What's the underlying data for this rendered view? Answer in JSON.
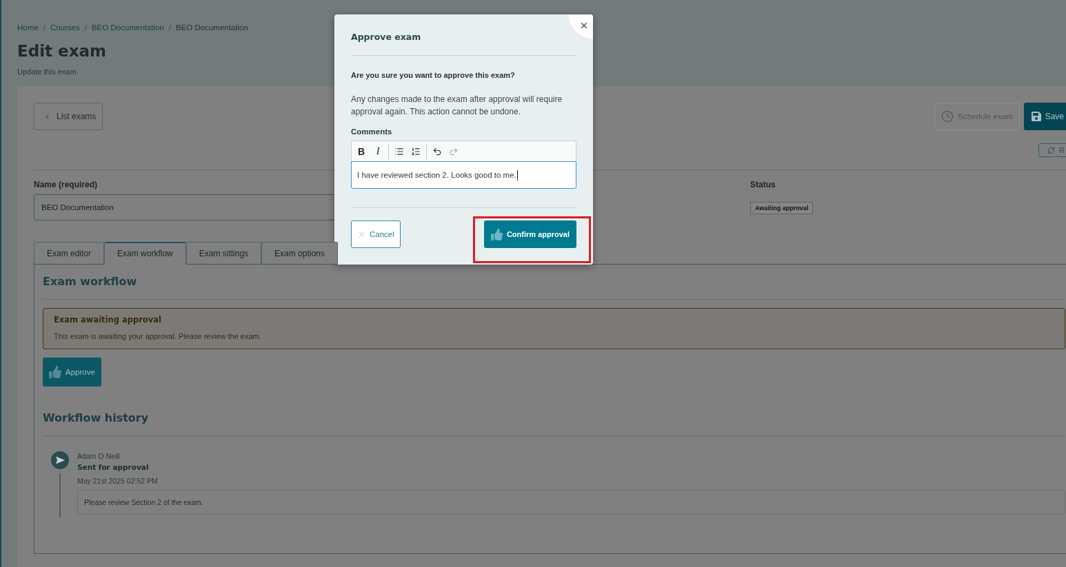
{
  "breadcrumb": [
    {
      "label": "Home",
      "current": false,
      "separator": "/"
    },
    {
      "label": "Courses",
      "current": false,
      "separator": "/"
    },
    {
      "label": "BEO Documentation",
      "current": false,
      "separator": "/"
    },
    {
      "label": "BEO Documentation",
      "current": true
    }
  ],
  "page": {
    "title": "Edit exam",
    "subtitle": "Update this exam"
  },
  "toolbar": {
    "back_button": {
      "label": "List exams"
    },
    "schedule_button": {
      "label": "Schedule exam",
      "disabled": true
    },
    "save_button": {
      "label": "Save"
    },
    "refresh_button": {
      "label": "R"
    }
  },
  "form": {
    "name": {
      "label": "Name (required)",
      "value": "BEO Documentation"
    },
    "status": {
      "label": "Status",
      "value": "Awaiting approval"
    }
  },
  "tabs": [
    {
      "label": "Exam editor",
      "selected": false
    },
    {
      "label": "Exam workflow",
      "selected": true
    },
    {
      "label": "Exam sittings",
      "selected": false
    },
    {
      "label": "Exam options",
      "selected": false
    }
  ],
  "workflow": {
    "title": "Exam workflow",
    "alert": {
      "title": "Exam awaiting approval",
      "message": "This exam is awaiting your approval. Please review the exam."
    },
    "approve_button": {
      "label": "Approve"
    },
    "history_title": "Workflow history",
    "history": [
      {
        "author": "Adam O Neill",
        "action": "Sent for approval",
        "date": "May 21st 2025 02:52 PM",
        "comment": "Please review Section 2 of the exam."
      }
    ]
  },
  "dialog": {
    "title": "Approve exam",
    "question": "Are you sure you want to approve this exam?",
    "message": "Any changes made to the exam after approval will require approval again. This action cannot be undone.",
    "comments_label": "Comments",
    "editor_tools": [
      {
        "kind": "bold",
        "label": "B",
        "disabled": false
      },
      {
        "kind": "italic",
        "label": "I",
        "disabled": false
      },
      {
        "kind": "bullet_list",
        "disabled": false
      },
      {
        "kind": "ordered_list",
        "disabled": false
      },
      {
        "kind": "undo",
        "disabled": false
      },
      {
        "kind": "redo",
        "disabled": true
      }
    ],
    "comment": {
      "value": "I have reviewed section 2. Looks good to me.",
      "focused": true
    },
    "cancel_button": {
      "label": "Cancel"
    },
    "confirm_button": {
      "label": "Confirm approval"
    }
  }
}
